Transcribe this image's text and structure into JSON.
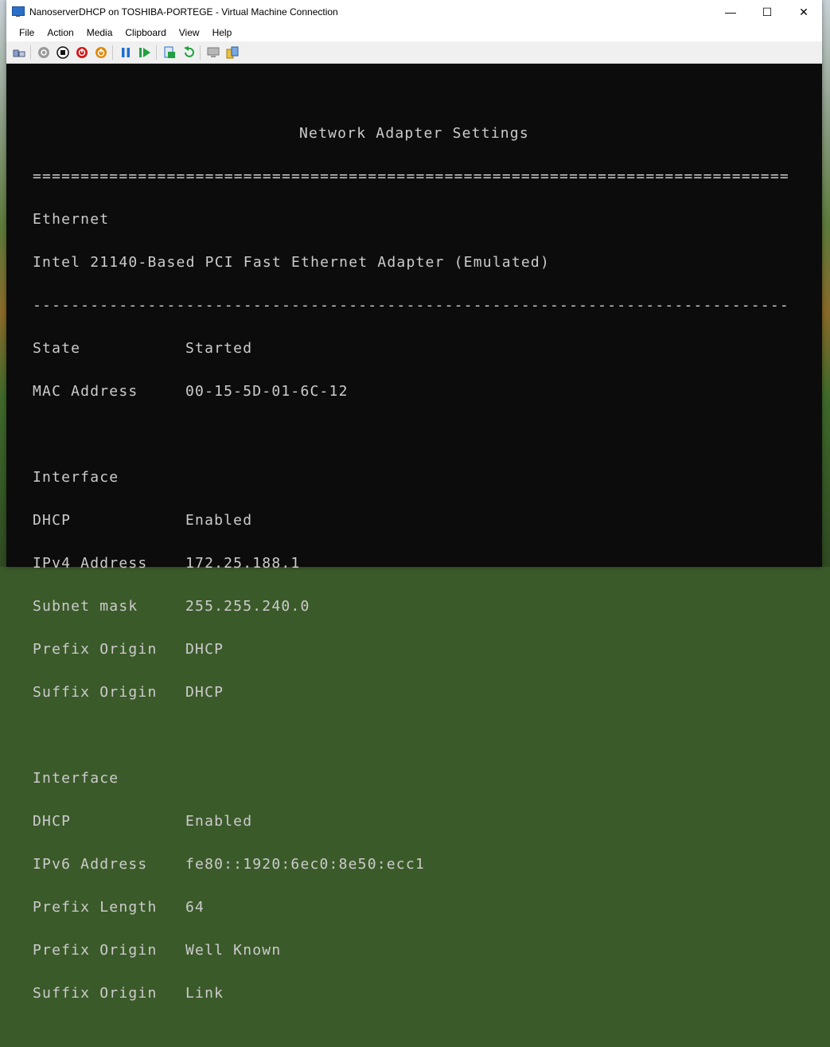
{
  "window": {
    "title": "NanoserverDHCP on TOSHIBA-PORTEGE - Virtual Machine Connection",
    "minimize_glyph": "—",
    "maximize_glyph": "☐",
    "close_glyph": "✕"
  },
  "menu": [
    "File",
    "Action",
    "Media",
    "Clipboard",
    "View",
    "Help"
  ],
  "toolbar": {
    "icons": [
      "ctrl-alt-del-icon",
      "start-icon",
      "turn-off-icon",
      "shut-down-icon",
      "power-icon",
      "pause-icon",
      "resume-icon",
      "checkpoint-icon",
      "revert-icon",
      "enhanced-session-icon",
      "share-icon"
    ],
    "colors": {
      "gray": "#9a9a9a",
      "black": "#111111",
      "red": "#d01818",
      "orange": "#e0880a",
      "blue": "#1f6fd0",
      "green": "#20a040"
    }
  },
  "console": {
    "heading": "Network Adapter Settings",
    "double_rule": "===============================================================================",
    "single_rule": "-------------------------------------------------------------------------------",
    "adapter_name": "Ethernet",
    "adapter_desc": "Intel 21140-Based PCI Fast Ethernet Adapter (Emulated)",
    "state": {
      "label": "State",
      "value": "Started"
    },
    "mac": {
      "label": "MAC Address",
      "value": "00-15-5D-01-6C-12"
    },
    "iface1": {
      "title": "Interface",
      "dhcp": {
        "label": "DHCP",
        "value": "Enabled"
      },
      "addr": {
        "label": "IPv4 Address",
        "value": "172.25.188.1"
      },
      "mask": {
        "label": "Subnet mask",
        "value": "255.255.240.0"
      },
      "prefix_origin": {
        "label": "Prefix Origin",
        "value": "DHCP"
      },
      "suffix_origin": {
        "label": "Suffix Origin",
        "value": "DHCP"
      }
    },
    "iface2": {
      "title": "Interface",
      "dhcp": {
        "label": "DHCP",
        "value": "Enabled"
      },
      "addr": {
        "label": "IPv6 Address",
        "value": "fe80::1920:6ec0:8e50:ecc1"
      },
      "prefix_length": {
        "label": "Prefix Length",
        "value": "64"
      },
      "prefix_origin": {
        "label": "Prefix Origin",
        "value": "Well Known"
      },
      "suffix_origin": {
        "label": "Suffix Origin",
        "value": "Link"
      }
    }
  }
}
